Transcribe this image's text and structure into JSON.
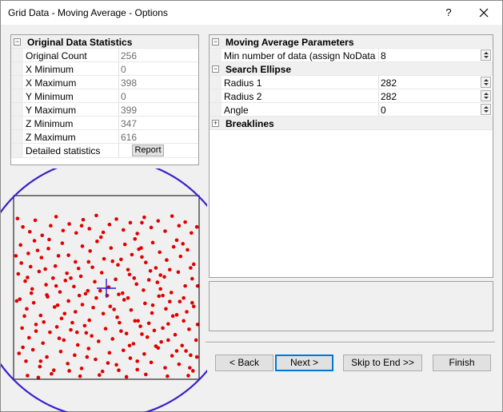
{
  "window": {
    "title": "Grid Data - Moving Average - Options",
    "help_label": "?"
  },
  "statistics": {
    "header": "Original Data Statistics",
    "rows": [
      {
        "name": "Original Count",
        "value": "256"
      },
      {
        "name": "X Minimum",
        "value": "0"
      },
      {
        "name": "X Maximum",
        "value": "398"
      },
      {
        "name": "Y Minimum",
        "value": "0"
      },
      {
        "name": "Y Maximum",
        "value": "399"
      },
      {
        "name": "Z Minimum",
        "value": "347"
      },
      {
        "name": "Z Maximum",
        "value": "616"
      }
    ],
    "detailed": {
      "name": "Detailed statistics",
      "button": "Report"
    }
  },
  "parameters": {
    "moving_average": {
      "header": "Moving Average Parameters",
      "min_data_label": "Min number of data (assign NoData if...",
      "min_data_value": "8"
    },
    "search_ellipse": {
      "header": "Search Ellipse",
      "radius1_label": "Radius 1",
      "radius1_value": "282",
      "radius2_label": "Radius 2",
      "radius2_value": "282",
      "angle_label": "Angle",
      "angle_value": "0"
    },
    "breaklines": {
      "header": "Breaklines"
    }
  },
  "buttons": {
    "back": "< Back",
    "next": "Next >",
    "skip": "Skip to End >>",
    "finish": "Finish"
  },
  "colors": {
    "points": "#e00000",
    "ellipse": "#3a1fc9",
    "center_cross": "#2b1acb",
    "default_button_border": "#0078d7"
  },
  "data_points": [
    [
      5,
      38
    ],
    [
      12,
      52
    ],
    [
      21,
      60
    ],
    [
      28,
      41
    ],
    [
      37,
      66
    ],
    [
      48,
      50
    ],
    [
      55,
      35
    ],
    [
      64,
      58
    ],
    [
      72,
      47
    ],
    [
      81,
      62
    ],
    [
      90,
      40
    ],
    [
      98,
      55
    ],
    [
      107,
      33
    ],
    [
      116,
      61
    ],
    [
      124,
      48
    ],
    [
      133,
      39
    ],
    [
      142,
      57
    ],
    [
      151,
      45
    ],
    [
      160,
      63
    ],
    [
      169,
      36
    ],
    [
      178,
      53
    ],
    [
      187,
      42
    ],
    [
      196,
      59
    ],
    [
      205,
      34
    ],
    [
      214,
      50
    ],
    [
      222,
      44
    ],
    [
      230,
      62
    ],
    [
      9,
      82
    ],
    [
      19,
      96
    ],
    [
      27,
      75
    ],
    [
      36,
      103
    ],
    [
      45,
      88
    ],
    [
      54,
      117
    ],
    [
      63,
      79
    ],
    [
      71,
      99
    ],
    [
      80,
      110
    ],
    [
      89,
      84
    ],
    [
      99,
      92
    ],
    [
      108,
      76
    ],
    [
      117,
      105
    ],
    [
      126,
      87
    ],
    [
      135,
      115
    ],
    [
      144,
      81
    ],
    [
      153,
      98
    ],
    [
      162,
      89
    ],
    [
      171,
      111
    ],
    [
      180,
      78
    ],
    [
      189,
      94
    ],
    [
      198,
      107
    ],
    [
      207,
      85
    ],
    [
      216,
      101
    ],
    [
      225,
      90
    ],
    [
      233,
      114
    ],
    [
      6,
      130
    ],
    [
      15,
      142
    ],
    [
      24,
      155
    ],
    [
      33,
      126
    ],
    [
      42,
      148
    ],
    [
      51,
      137
    ],
    [
      60,
      160
    ],
    [
      69,
      129
    ],
    [
      78,
      151
    ],
    [
      87,
      134
    ],
    [
      96,
      158
    ],
    [
      105,
      143
    ],
    [
      114,
      128
    ],
    [
      123,
      152
    ],
    [
      132,
      139
    ],
    [
      141,
      162
    ],
    [
      150,
      131
    ],
    [
      159,
      147
    ],
    [
      168,
      157
    ],
    [
      177,
      125
    ],
    [
      186,
      144
    ],
    [
      195,
      135
    ],
    [
      204,
      161
    ],
    [
      213,
      127
    ],
    [
      222,
      150
    ],
    [
      231,
      138
    ],
    [
      8,
      172
    ],
    [
      17,
      188
    ],
    [
      26,
      178
    ],
    [
      35,
      199
    ],
    [
      44,
      168
    ],
    [
      53,
      185
    ],
    [
      62,
      204
    ],
    [
      71,
      175
    ],
    [
      80,
      193
    ],
    [
      89,
      181
    ],
    [
      98,
      207
    ],
    [
      107,
      170
    ],
    [
      116,
      196
    ],
    [
      125,
      184
    ],
    [
      134,
      202
    ],
    [
      143,
      173
    ],
    [
      152,
      190
    ],
    [
      161,
      208
    ],
    [
      170,
      179
    ],
    [
      179,
      195
    ],
    [
      188,
      167
    ],
    [
      197,
      188
    ],
    [
      206,
      200
    ],
    [
      215,
      176
    ],
    [
      224,
      193
    ],
    [
      233,
      184
    ],
    [
      11,
      220
    ],
    [
      20,
      236
    ],
    [
      29,
      214
    ],
    [
      38,
      245
    ],
    [
      47,
      227
    ],
    [
      56,
      218
    ],
    [
      65,
      240
    ],
    [
      74,
      223
    ],
    [
      83,
      248
    ],
    [
      92,
      216
    ],
    [
      101,
      233
    ],
    [
      110,
      242
    ],
    [
      119,
      221
    ],
    [
      128,
      238
    ],
    [
      137,
      211
    ],
    [
      146,
      229
    ],
    [
      155,
      246
    ],
    [
      164,
      217
    ],
    [
      173,
      235
    ],
    [
      182,
      224
    ],
    [
      191,
      243
    ],
    [
      200,
      213
    ],
    [
      209,
      231
    ],
    [
      218,
      249
    ],
    [
      227,
      222
    ],
    [
      236,
      240
    ],
    [
      7,
      262
    ],
    [
      16,
      275
    ],
    [
      25,
      256
    ],
    [
      34,
      284
    ],
    [
      43,
      268
    ],
    [
      52,
      290
    ],
    [
      61,
      259
    ],
    [
      70,
      279
    ],
    [
      79,
      265
    ],
    [
      88,
      287
    ],
    [
      97,
      254
    ],
    [
      106,
      272
    ],
    [
      115,
      292
    ],
    [
      124,
      261
    ],
    [
      133,
      281
    ],
    [
      142,
      257
    ],
    [
      151,
      270
    ],
    [
      160,
      289
    ],
    [
      169,
      263
    ],
    [
      178,
      277
    ],
    [
      187,
      253
    ],
    [
      196,
      286
    ],
    [
      205,
      266
    ],
    [
      214,
      280
    ],
    [
      223,
      258
    ],
    [
      232,
      291
    ],
    [
      10,
      112
    ],
    [
      22,
      118
    ],
    [
      31,
      91
    ],
    [
      41,
      122
    ],
    [
      58,
      100
    ],
    [
      67,
      141
    ],
    [
      84,
      121
    ],
    [
      93,
      163
    ],
    [
      102,
      119
    ],
    [
      121,
      166
    ],
    [
      139,
      106
    ],
    [
      148,
      123
    ],
    [
      157,
      72
    ],
    [
      166,
      102
    ],
    [
      175,
      140
    ],
    [
      184,
      120
    ],
    [
      193,
      166
    ],
    [
      202,
      123
    ],
    [
      211,
      74
    ],
    [
      220,
      170
    ],
    [
      229,
      120
    ],
    [
      14,
      200
    ],
    [
      23,
      162
    ],
    [
      39,
      210
    ],
    [
      57,
      182
    ],
    [
      66,
      196
    ],
    [
      76,
      211
    ],
    [
      85,
      166
    ],
    [
      94,
      228
    ],
    [
      103,
      186
    ],
    [
      112,
      158
    ],
    [
      130,
      189
    ],
    [
      139,
      225
    ],
    [
      148,
      170
    ],
    [
      157,
      208
    ],
    [
      166,
      230
    ],
    [
      175,
      212
    ],
    [
      184,
      250
    ],
    [
      193,
      220
    ],
    [
      202,
      176
    ],
    [
      211,
      258
    ],
    [
      220,
      208
    ],
    [
      229,
      265
    ],
    [
      18,
      299
    ],
    [
      32,
      302
    ],
    [
      49,
      296
    ],
    [
      86,
      300
    ],
    [
      111,
      298
    ],
    [
      146,
      301
    ],
    [
      171,
      297
    ],
    [
      199,
      300
    ],
    [
      226,
      299
    ],
    [
      237,
      52
    ],
    [
      3,
      100
    ],
    [
      238,
      150
    ],
    [
      4,
      175
    ],
    [
      238,
      214
    ],
    [
      12,
      252
    ],
    [
      237,
      268
    ],
    [
      46,
      73
    ],
    [
      113,
      69
    ],
    [
      165,
      87
    ],
    [
      219,
      80
    ],
    [
      74,
      137
    ],
    [
      128,
      109
    ],
    [
      190,
      132
    ],
    [
      59,
      237
    ],
    [
      150,
      249
    ],
    [
      200,
      240
    ],
    [
      35,
      275
    ],
    [
      95,
      268
    ],
    [
      160,
      275
    ],
    [
      228,
      286
    ],
    [
      43,
      165
    ],
    [
      136,
      164
    ],
    [
      55,
      150
    ],
    [
      190,
      155
    ],
    [
      82,
      227
    ],
    [
      122,
      278
    ],
    [
      180,
      182
    ],
    [
      29,
      225
    ],
    [
      211,
      198
    ],
    [
      97,
      110
    ],
    [
      156,
      137
    ],
    [
      72,
      291
    ],
    [
      136,
      290
    ],
    [
      18,
      136
    ],
    [
      231,
      178
    ],
    [
      88,
      50
    ],
    [
      166,
      45
    ]
  ]
}
